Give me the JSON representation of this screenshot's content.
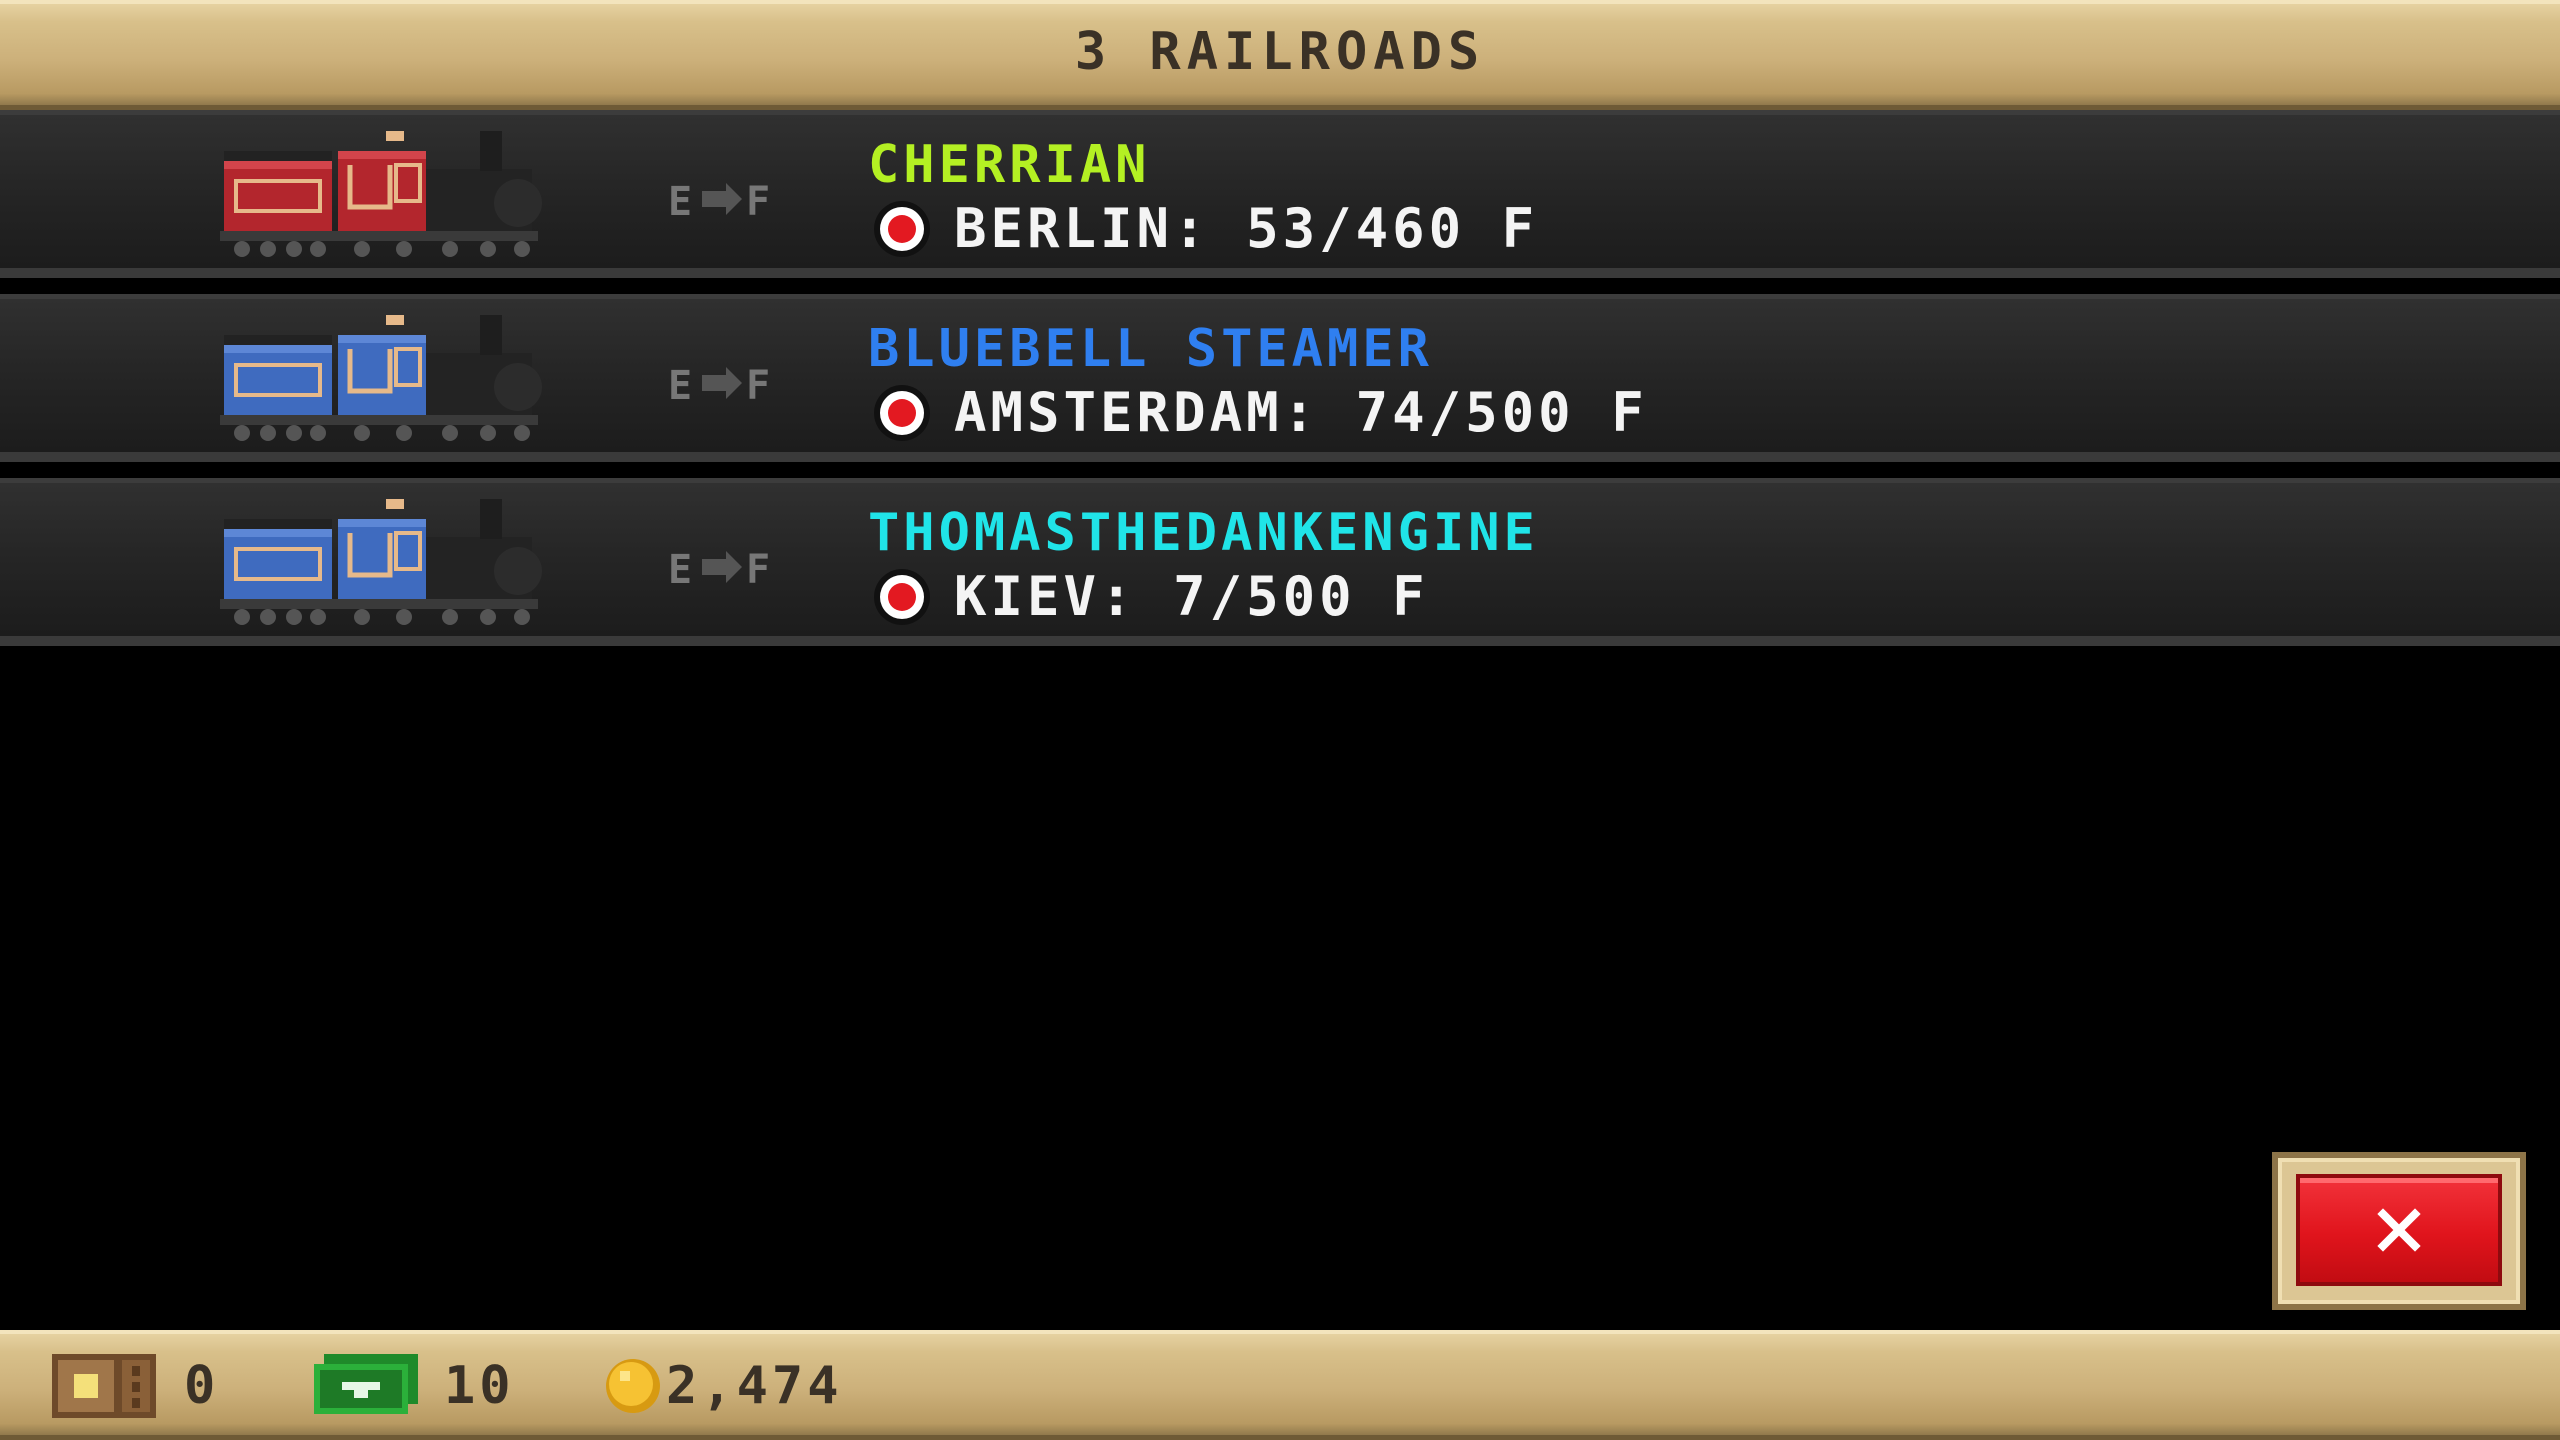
{
  "header": {
    "title": "3 RAILROADS"
  },
  "railroads": [
    {
      "name": "CHERRIAN",
      "name_color": "#b4f023",
      "train_color": "red",
      "gauge_label": "E F",
      "status_icon": "red-dot-icon",
      "city_status": "BERLIN: 53/460 F"
    },
    {
      "name": "BLUEBELL STEAMER",
      "name_color": "#2f7ff0",
      "train_color": "blue",
      "gauge_label": "E F",
      "status_icon": "red-dot-icon",
      "city_status": "AMSTERDAM: 74/500 F"
    },
    {
      "name": "THOMASTHEDANKENGINE",
      "name_color": "#20e4e8",
      "train_color": "blue",
      "gauge_label": "E F",
      "status_icon": "red-dot-icon",
      "city_status": "KIEV: 7/500 F"
    }
  ],
  "close_button": {
    "icon": "close-icon",
    "color": "#e0141c"
  },
  "footer": {
    "crate_icon": "crate-icon",
    "crates": "0",
    "cash_icon": "cash-icon",
    "cash": "10",
    "coin_icon": "coin-icon",
    "coins": "2,474"
  }
}
